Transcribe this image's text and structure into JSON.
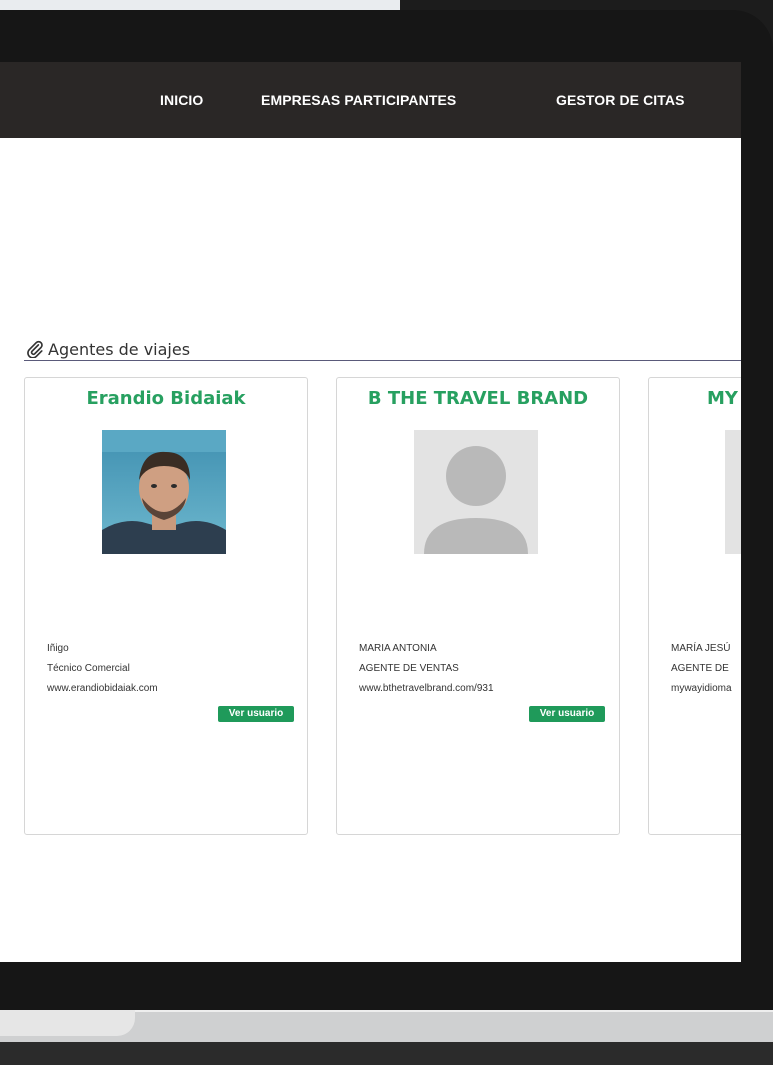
{
  "nav": {
    "items": [
      {
        "label": "INICIO"
      },
      {
        "label": "EMPRESAS PARTICIPANTES"
      },
      {
        "label": "GESTOR DE CITAS"
      }
    ]
  },
  "section": {
    "title": "Agentes de viajes",
    "icon": "paperclip-icon"
  },
  "cards": [
    {
      "title": "Erandio Bidaiak",
      "name": "Iñigo",
      "role": "Técnico Comercial",
      "website": "www.erandiobidaiak.com",
      "button": "Ver usuario",
      "avatar": "user-photo"
    },
    {
      "title": "B THE TRAVEL BRAND",
      "name": "MARIA ANTONIA",
      "role": "AGENTE DE VENTAS",
      "website": "www.bthetravelbrand.com/931",
      "button": "Ver usuario",
      "avatar": "default-avatar-icon"
    },
    {
      "title": "MY",
      "name": "MARÍA JESÚ",
      "role": "AGENTE DE",
      "website": "mywayidioma",
      "avatar": "default-avatar-icon"
    }
  ],
  "colors": {
    "nav_bg": "#2a2726",
    "accent_green": "#27a060",
    "button_green": "#1f9a5a"
  }
}
